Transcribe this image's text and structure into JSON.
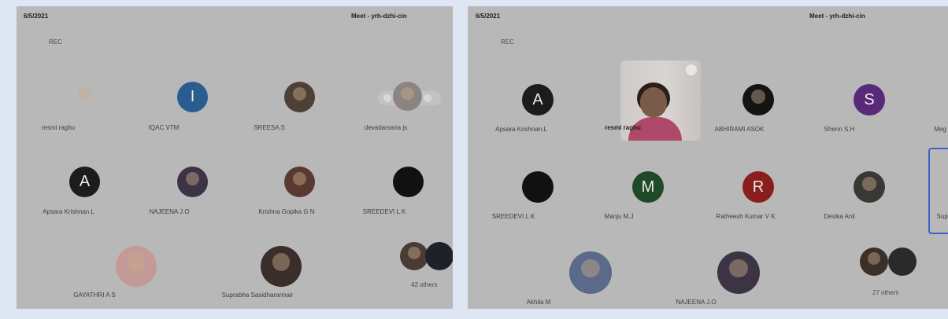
{
  "colors": {
    "background": "#dde6f2",
    "panel": "#b8b8b8",
    "selected_border": "#3e63c9"
  },
  "left": {
    "date": "6/5/2021",
    "meet_code": "Meet - yrh-dzhi-cin",
    "rec": "REC",
    "participants": [
      {
        "name": "resmi raghu",
        "initial": "",
        "color": "#4a3a28"
      },
      {
        "name": "IQAC VTM",
        "initial": "I",
        "color": "#2a5d8f"
      },
      {
        "name": "SREESA S",
        "initial": "",
        "color": "#4e4034"
      },
      {
        "name": "devadarsana js",
        "initial": "",
        "color": "#8c8480"
      },
      {
        "name": "Apsara Krishnan.L",
        "initial": "A",
        "color": "#1c1c1c"
      },
      {
        "name": "NAJEENA J.O",
        "initial": "",
        "color": "#3c3444"
      },
      {
        "name": "Krishna Gopika G N",
        "initial": "",
        "color": "#5a3a30"
      },
      {
        "name": "SREEDEVI L K",
        "initial": "",
        "color": "#111111"
      },
      {
        "name": "GAYATHRI A S",
        "initial": "",
        "color": "#c49a96"
      },
      {
        "name": "Suprabha Sasidharannair",
        "initial": "",
        "color": "#3a2e2a"
      }
    ],
    "others": "42 others"
  },
  "right": {
    "date": "6/5/2021",
    "meet_code": "Meet - yrh-dzhi-cin",
    "rec": "REC",
    "video_name": "resmi raghu",
    "participants": [
      {
        "name": "Apsara Krishnan.L",
        "initial": "A",
        "color": "#1c1c1c"
      },
      {
        "name": "ABHIRAMI ASOK",
        "initial": "",
        "color": "#141414"
      },
      {
        "name": "Sherin S.H",
        "initial": "S",
        "color": "#5a2a7a"
      },
      {
        "name": "Meg",
        "initial": "",
        "color": "#b8b8b8"
      },
      {
        "name": "SREEDEVI L K",
        "initial": "",
        "color": "#111111"
      },
      {
        "name": "Manju M.J",
        "initial": "M",
        "color": "#1f4a2a"
      },
      {
        "name": "Ratheesh Kumar V K",
        "initial": "R",
        "color": "#8a1e1e"
      },
      {
        "name": "Devika Anil",
        "initial": "",
        "color": "#3a3834"
      },
      {
        "name": "Supr",
        "initial": "",
        "color": "#b8b8b8"
      },
      {
        "name": "Akhila M",
        "initial": "",
        "color": "#5a6a88"
      },
      {
        "name": "NAJEENA J.O",
        "initial": "",
        "color": "#3c3444"
      }
    ],
    "others": "27 others"
  }
}
